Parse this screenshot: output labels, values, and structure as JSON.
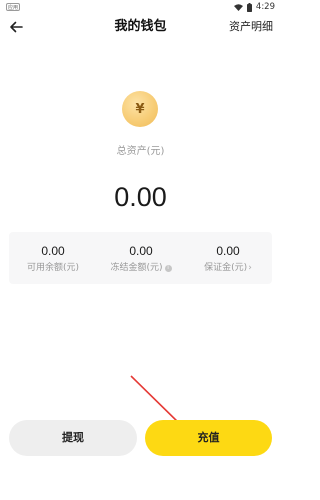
{
  "status_bar": {
    "left_badge": "应用",
    "time": "4:29"
  },
  "nav": {
    "title": "我的钱包",
    "right_link": "资产明细"
  },
  "wallet": {
    "coin_symbol": "¥",
    "total_label": "总资产(元)",
    "total_value": "0.00"
  },
  "balances": [
    {
      "value": "0.00",
      "label": "可用余额(元)"
    },
    {
      "value": "0.00",
      "label": "冻结金额(元)"
    },
    {
      "value": "0.00",
      "label": "保证金(元)"
    }
  ],
  "buttons": {
    "withdraw": "提现",
    "recharge": "充值"
  },
  "colors": {
    "accent": "#fdd913",
    "coin": "#f7cd77",
    "annotation_arrow": "#e53935"
  }
}
